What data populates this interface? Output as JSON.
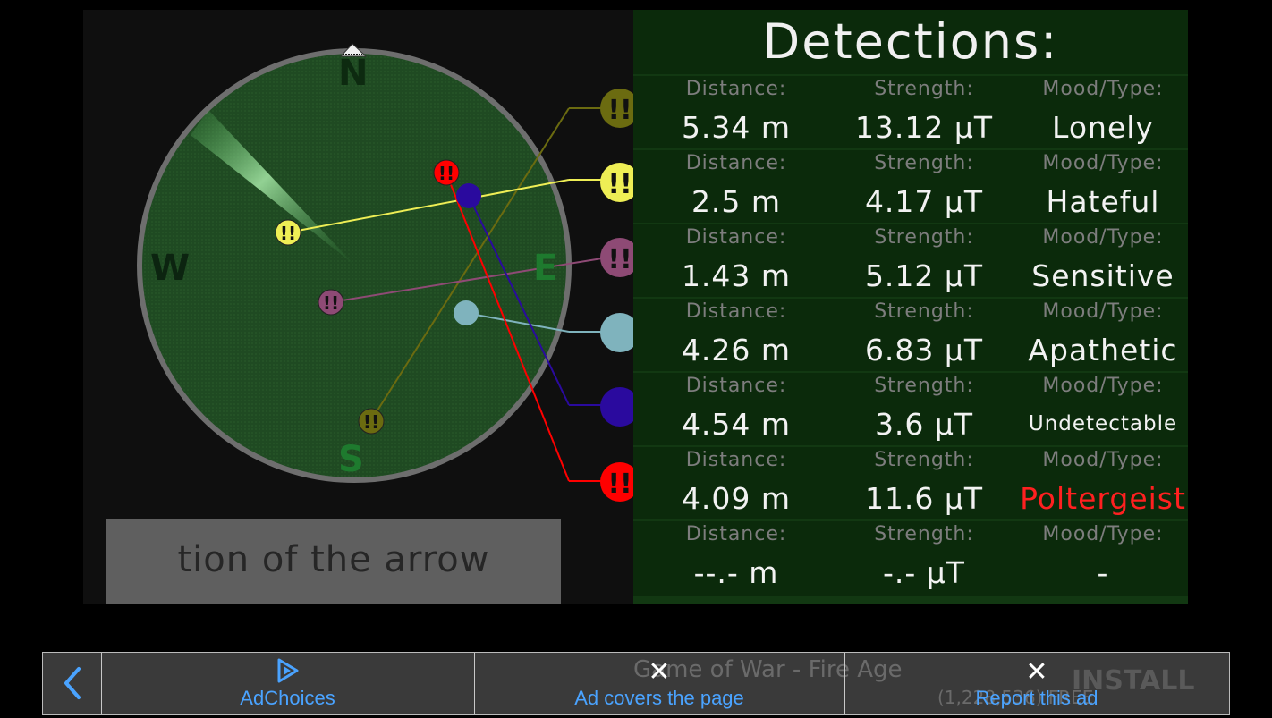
{
  "compass": {
    "north": "N",
    "south": "S",
    "east": "E",
    "west": "W"
  },
  "hint_text": "tion of the arrow",
  "panel": {
    "title": "Detections:",
    "rows": [
      {
        "distance_label": "Distance:",
        "strength_label": "Strength:",
        "mood_label": "Mood/Type:",
        "distance": "5.34 m",
        "strength": "13.12 μT",
        "mood": "Lonely",
        "mood_color": "#f2f2f2",
        "marker_color": "#6b6b10"
      },
      {
        "distance_label": "Distance:",
        "strength_label": "Strength:",
        "mood_label": "Mood/Type:",
        "distance": "2.5 m",
        "strength": "4.17 μT",
        "mood": "Hateful",
        "mood_color": "#f2f2f2",
        "marker_color": "#eeee55"
      },
      {
        "distance_label": "Distance:",
        "strength_label": "Strength:",
        "mood_label": "Mood/Type:",
        "distance": "1.43 m",
        "strength": "5.12 μT",
        "mood": "Sensitive",
        "mood_color": "#f2f2f2",
        "marker_color": "#8e4a75"
      },
      {
        "distance_label": "Distance:",
        "strength_label": "Strength:",
        "mood_label": "Mood/Type:",
        "distance": "4.26 m",
        "strength": "6.83 μT",
        "mood": "Apathetic",
        "mood_color": "#f2f2f2",
        "marker_color": "#7fb3bd"
      },
      {
        "distance_label": "Distance:",
        "strength_label": "Strength:",
        "mood_label": "Mood/Type:",
        "distance": "4.54 m",
        "strength": "3.6 μT",
        "mood": "Undetectable",
        "mood_color": "#f2f2f2",
        "marker_color": "#2a0a9e"
      },
      {
        "distance_label": "Distance:",
        "strength_label": "Strength:",
        "mood_label": "Mood/Type:",
        "distance": "4.09 m",
        "strength": "11.6 μT",
        "mood": "Poltergeist",
        "mood_color": "#ff2020",
        "marker_color": "#ff0000"
      },
      {
        "distance_label": "Distance:",
        "strength_label": "Strength:",
        "mood_label": "Mood/Type:",
        "distance": "--.- m",
        "strength": "-.- μT",
        "mood": "-",
        "mood_color": "#f2f2f2",
        "marker_color": ""
      }
    ]
  },
  "markers": {
    "alert_glyph": "!!"
  },
  "adbar": {
    "back_icon": "chevron-left-icon",
    "adchoices_label": "AdChoices",
    "ad_covers_label": "Ad covers the page",
    "report_label": "Report this ad",
    "close_glyph": "✕",
    "background_title": "Game of War - Fire Age",
    "background_sub": "(1,228,536) FREE",
    "background_install": "INSTALL"
  },
  "colors": {
    "radar_fill": "#1f4a22",
    "radar_ring": "#6e6e6e",
    "panel_bg": "#0b2a0b",
    "ad_link": "#4aa3ff"
  }
}
